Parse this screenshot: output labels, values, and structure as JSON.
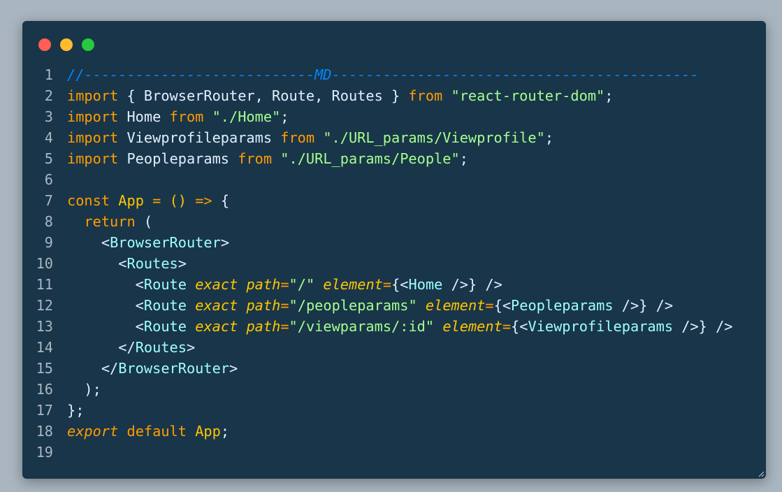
{
  "window": {
    "dots": [
      {
        "name": "close",
        "color": "#ff5f56"
      },
      {
        "name": "minimize",
        "color": "#ffbd2e"
      },
      {
        "name": "maximize",
        "color": "#27c93f"
      }
    ]
  },
  "code": {
    "lines": [
      {
        "n": "1",
        "tokens": [
          {
            "c": "cmt",
            "t": "//---------------------------MD-------------------------------------------"
          }
        ]
      },
      {
        "n": "2",
        "tokens": [
          {
            "c": "kw",
            "t": "import"
          },
          {
            "c": "pun",
            "t": " { BrowserRouter, Route, Routes } "
          },
          {
            "c": "kw",
            "t": "from"
          },
          {
            "c": "pun",
            "t": " "
          },
          {
            "c": "str",
            "t": "\"react-router-dom\""
          },
          {
            "c": "pun",
            "t": ";"
          }
        ]
      },
      {
        "n": "3",
        "tokens": [
          {
            "c": "kw",
            "t": "import"
          },
          {
            "c": "pun",
            "t": " Home "
          },
          {
            "c": "kw",
            "t": "from"
          },
          {
            "c": "pun",
            "t": " "
          },
          {
            "c": "str",
            "t": "\"./Home\""
          },
          {
            "c": "pun",
            "t": ";"
          }
        ]
      },
      {
        "n": "4",
        "tokens": [
          {
            "c": "kw",
            "t": "import"
          },
          {
            "c": "pun",
            "t": " Viewprofileparams "
          },
          {
            "c": "kw",
            "t": "from"
          },
          {
            "c": "pun",
            "t": " "
          },
          {
            "c": "str",
            "t": "\"./URL_params/Viewprofile\""
          },
          {
            "c": "pun",
            "t": ";"
          }
        ]
      },
      {
        "n": "5",
        "tokens": [
          {
            "c": "kw",
            "t": "import"
          },
          {
            "c": "pun",
            "t": " Peopleparams "
          },
          {
            "c": "kw",
            "t": "from"
          },
          {
            "c": "pun",
            "t": " "
          },
          {
            "c": "str",
            "t": "\"./URL_params/People\""
          },
          {
            "c": "pun",
            "t": ";"
          }
        ]
      },
      {
        "n": "6",
        "tokens": []
      },
      {
        "n": "7",
        "tokens": [
          {
            "c": "kw",
            "t": "const"
          },
          {
            "c": "pun",
            "t": " "
          },
          {
            "c": "fn",
            "t": "App"
          },
          {
            "c": "pun",
            "t": " "
          },
          {
            "c": "op",
            "t": "="
          },
          {
            "c": "pun",
            "t": " "
          },
          {
            "c": "fn",
            "t": "()"
          },
          {
            "c": "pun",
            "t": " "
          },
          {
            "c": "op",
            "t": "=>"
          },
          {
            "c": "pun",
            "t": " {"
          }
        ]
      },
      {
        "n": "8",
        "tokens": [
          {
            "c": "pun",
            "t": "  "
          },
          {
            "c": "kw",
            "t": "return"
          },
          {
            "c": "pun",
            "t": " ("
          }
        ]
      },
      {
        "n": "9",
        "tokens": [
          {
            "c": "pun",
            "t": "    <"
          },
          {
            "c": "tag",
            "t": "BrowserRouter"
          },
          {
            "c": "pun",
            "t": ">"
          }
        ]
      },
      {
        "n": "10",
        "tokens": [
          {
            "c": "pun",
            "t": "      <"
          },
          {
            "c": "tag",
            "t": "Routes"
          },
          {
            "c": "pun",
            "t": ">"
          }
        ]
      },
      {
        "n": "11",
        "tokens": [
          {
            "c": "pun",
            "t": "        <"
          },
          {
            "c": "tag",
            "t": "Route"
          },
          {
            "c": "pun",
            "t": " "
          },
          {
            "c": "attr",
            "t": "exact"
          },
          {
            "c": "pun",
            "t": " "
          },
          {
            "c": "attr",
            "t": "path"
          },
          {
            "c": "op",
            "t": "="
          },
          {
            "c": "str",
            "t": "\"/\""
          },
          {
            "c": "pun",
            "t": " "
          },
          {
            "c": "attr",
            "t": "element"
          },
          {
            "c": "op",
            "t": "="
          },
          {
            "c": "pun",
            "t": "{<"
          },
          {
            "c": "tag",
            "t": "Home"
          },
          {
            "c": "pun",
            "t": " />} />"
          }
        ]
      },
      {
        "n": "12",
        "tokens": [
          {
            "c": "pun",
            "t": "        <"
          },
          {
            "c": "tag",
            "t": "Route"
          },
          {
            "c": "pun",
            "t": " "
          },
          {
            "c": "attr",
            "t": "exact"
          },
          {
            "c": "pun",
            "t": " "
          },
          {
            "c": "attr",
            "t": "path"
          },
          {
            "c": "op",
            "t": "="
          },
          {
            "c": "str",
            "t": "\"/peopleparams\""
          },
          {
            "c": "pun",
            "t": " "
          },
          {
            "c": "attr",
            "t": "element"
          },
          {
            "c": "op",
            "t": "="
          },
          {
            "c": "pun",
            "t": "{<"
          },
          {
            "c": "tag",
            "t": "Peopleparams"
          },
          {
            "c": "pun",
            "t": " />} />"
          }
        ]
      },
      {
        "n": "13",
        "tokens": [
          {
            "c": "pun",
            "t": "        <"
          },
          {
            "c": "tag",
            "t": "Route"
          },
          {
            "c": "pun",
            "t": " "
          },
          {
            "c": "attr",
            "t": "exact"
          },
          {
            "c": "pun",
            "t": " "
          },
          {
            "c": "attr",
            "t": "path"
          },
          {
            "c": "op",
            "t": "="
          },
          {
            "c": "str",
            "t": "\"/viewparams/:id\""
          },
          {
            "c": "pun",
            "t": " "
          },
          {
            "c": "attr",
            "t": "element"
          },
          {
            "c": "op",
            "t": "="
          },
          {
            "c": "pun",
            "t": "{<"
          },
          {
            "c": "tag",
            "t": "Viewprofileparams"
          },
          {
            "c": "pun",
            "t": " />} />"
          }
        ]
      },
      {
        "n": "14",
        "tokens": [
          {
            "c": "pun",
            "t": "      </"
          },
          {
            "c": "tag",
            "t": "Routes"
          },
          {
            "c": "pun",
            "t": ">"
          }
        ]
      },
      {
        "n": "15",
        "tokens": [
          {
            "c": "pun",
            "t": "    </"
          },
          {
            "c": "tag",
            "t": "BrowserRouter"
          },
          {
            "c": "pun",
            "t": ">"
          }
        ]
      },
      {
        "n": "16",
        "tokens": [
          {
            "c": "pun",
            "t": "  );"
          }
        ]
      },
      {
        "n": "17",
        "tokens": [
          {
            "c": "pun",
            "t": "};"
          }
        ]
      },
      {
        "n": "18",
        "tokens": [
          {
            "c": "kwe",
            "t": "export"
          },
          {
            "c": "pun",
            "t": " "
          },
          {
            "c": "kw",
            "t": "default"
          },
          {
            "c": "pun",
            "t": " "
          },
          {
            "c": "fn",
            "t": "App"
          },
          {
            "c": "pun",
            "t": ";"
          }
        ]
      },
      {
        "n": "19",
        "tokens": []
      }
    ]
  }
}
